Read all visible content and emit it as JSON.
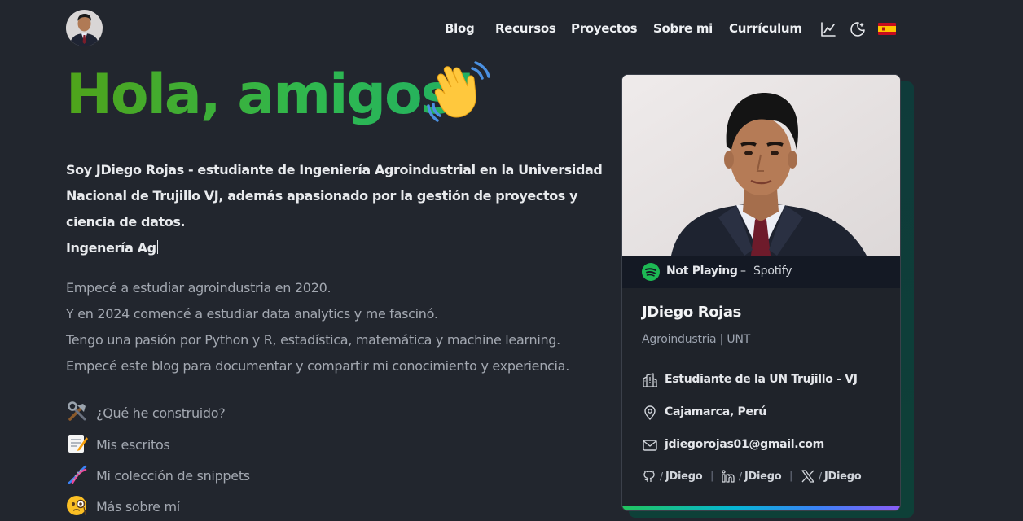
{
  "header": {
    "nav": [
      {
        "label": "Blog"
      },
      {
        "label": "Recursos"
      },
      {
        "label": "Proyectos"
      },
      {
        "label": "Sobre mi"
      },
      {
        "label": "Currículum"
      }
    ],
    "icons": [
      "chart-icon",
      "moon-icon",
      "spain-flag-icon"
    ]
  },
  "hero": {
    "title": "Hola, amigos!",
    "title_emoji": "waving-hand-icon",
    "intro": "Soy JDiego Rojas - estudiante de Ingeniería Agroindustrial en la Universidad Nacional de Trujillo VJ, además apasionado por la gestión de proyectos y ciencia de datos.",
    "typed_text": "Ingenería Ag",
    "about": [
      "Empecé a estudiar agroindustria en 2020.",
      "Y en 2024 comencé a estudiar data analytics y me fascinó.",
      "Tengo una pasión por Python y R, estadística, matemática y machine learning.",
      "Empecé este blog para documentar y compartir mi conocimiento y experiencia."
    ],
    "links": [
      {
        "icon": "tools-icon",
        "label": "¿Qué he construido?"
      },
      {
        "icon": "memo-icon",
        "label": "Mis escritos"
      },
      {
        "icon": "dna-icon",
        "label": "Mi colección de snippets"
      },
      {
        "icon": "monocle-face-icon",
        "label": "Más sobre mí"
      }
    ]
  },
  "card": {
    "spotify": {
      "status": "Not Playing",
      "separator": "–",
      "service": "Spotify"
    },
    "name": "JDiego Rojas",
    "role": "Agroindustria | UNT",
    "details": [
      {
        "icon": "building-icon",
        "text": "Estudiante de la UN Trujillo - VJ"
      },
      {
        "icon": "location-pin-icon",
        "text": "Cajamarca, Perú"
      },
      {
        "icon": "mail-icon",
        "text": "jdiegorojas01@gmail.com"
      }
    ],
    "socials": [
      {
        "icon": "github-icon",
        "slash": "/",
        "handle": "JDiego"
      },
      {
        "icon": "linkedin-icon",
        "slash": "/",
        "handle": "JDiego"
      },
      {
        "icon": "x-icon",
        "slash": "/",
        "handle": "JDiego"
      }
    ],
    "social_separator": "|"
  },
  "colors": {
    "background": "#22262e",
    "title_gradient_start": "#4fa31a",
    "title_gradient_end": "#22b062",
    "spotify_green": "#1db954",
    "muted_text": "#a3a8b1"
  }
}
